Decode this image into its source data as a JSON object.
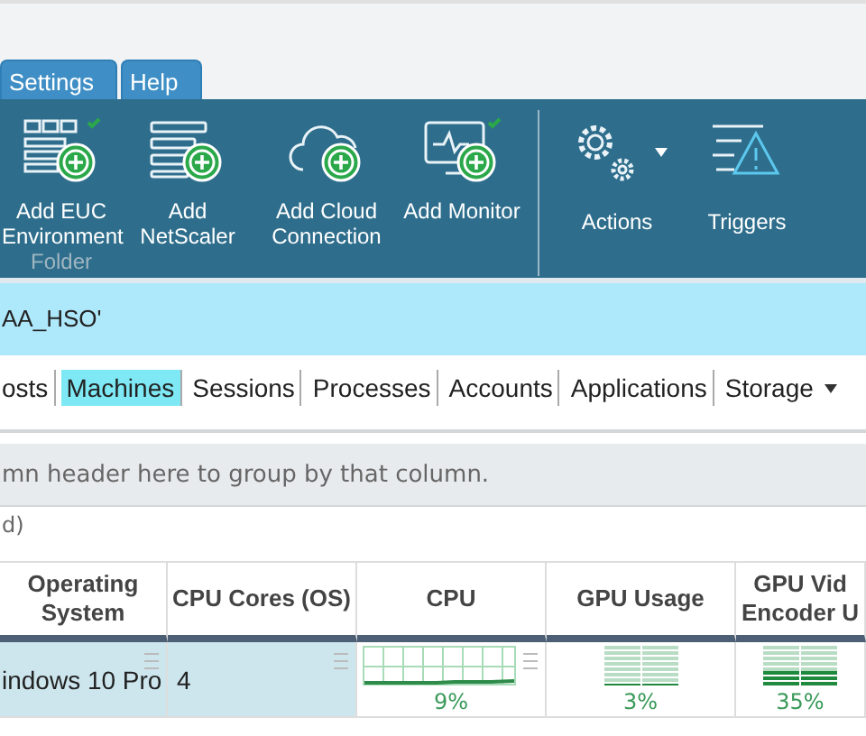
{
  "menu_tabs": [
    {
      "label": "Settings"
    },
    {
      "label": "Help"
    }
  ],
  "ribbon": {
    "buttons": [
      {
        "label": "Add EUC Environment",
        "sublabel": "Folder",
        "kind": "servers",
        "check": true
      },
      {
        "label": "Add NetScaler",
        "kind": "rack",
        "check": false
      },
      {
        "label": "Add Cloud Connection",
        "kind": "cloud",
        "check": false
      },
      {
        "label": "Add Monitor",
        "kind": "monitor",
        "check": true
      },
      {
        "label": "Actions",
        "kind": "gears",
        "dropdown": true,
        "group_start": true
      },
      {
        "label": "Triggers",
        "kind": "warning",
        "dropdown": false
      }
    ]
  },
  "context_bar": {
    "text": "AA_HSO'"
  },
  "views": [
    {
      "label": "osts",
      "selected": false
    },
    {
      "label": "Machines",
      "selected": true
    },
    {
      "label": "Sessions",
      "selected": false
    },
    {
      "label": "Processes",
      "selected": false
    },
    {
      "label": "Accounts",
      "selected": false
    },
    {
      "label": "Applications",
      "selected": false
    },
    {
      "label": "Storage",
      "selected": false,
      "dropdown": true
    }
  ],
  "group_panel": {
    "hint": "mn header here to group by that column."
  },
  "filter_text": "d)",
  "table": {
    "columns": [
      {
        "label": "Operating System"
      },
      {
        "label": "CPU Cores (OS)"
      },
      {
        "label": "CPU"
      },
      {
        "label": "GPU Usage"
      },
      {
        "label": "GPU Vid Encoder U"
      }
    ],
    "rows": [
      {
        "cells": [
          {
            "kind": "text",
            "text": "indows 10 Pro"
          },
          {
            "kind": "text",
            "text": "4"
          },
          {
            "kind": "graph",
            "reading": "9%"
          },
          {
            "kind": "bars",
            "level": 0.03,
            "reading": "3%"
          },
          {
            "kind": "bars",
            "level": 0.35,
            "reading": "35%"
          }
        ]
      }
    ]
  }
}
